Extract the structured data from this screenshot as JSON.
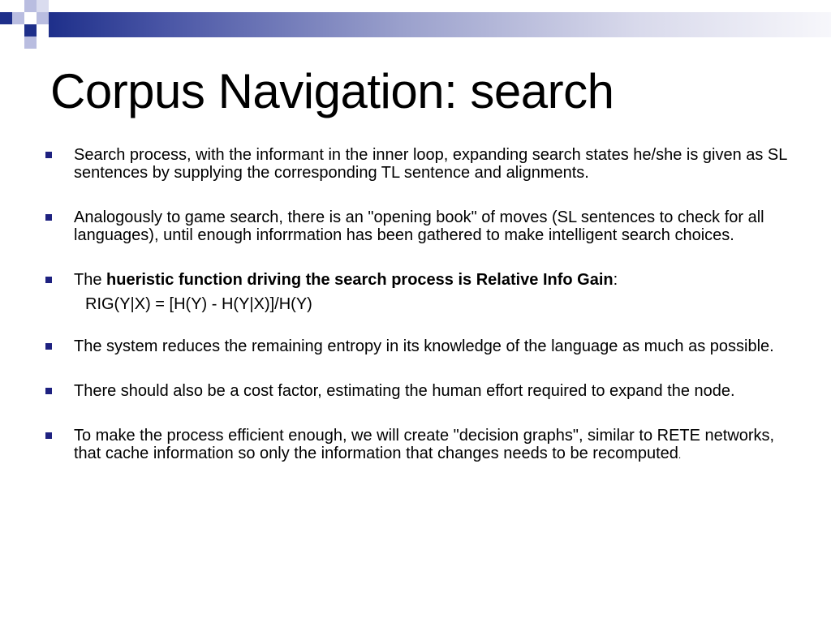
{
  "slide": {
    "title": "Corpus Navigation: search",
    "bullets": [
      {
        "text": "Search process, with the informant in the inner loop, expanding search states he/she is given as SL sentences by supplying the corresponding TL sentence and alignments."
      },
      {
        "text": "Analogously to game search, there is an \"opening book\" of moves (SL sentences to check for all languages), until enough inforrmation has been gathered to make intelligent search choices."
      },
      {
        "prefix": "The ",
        "bold": "hueristic function driving the search process is Relative Info Gain",
        "suffix": ":",
        "formula": "RIG(Y|X) = [H(Y) - H(Y|X)]/H(Y)"
      },
      {
        "text": "The system reduces the remaining entropy in its knowledge of the language as much as possible."
      },
      {
        "text": "There should also be a cost factor, estimating the human effort required to expand the node."
      },
      {
        "text": "To make the process efficient enough, we will create \"decision graphs\", similar to RETE networks, that cache information so only the information that changes needs to be recomputed",
        "trailing": "."
      }
    ]
  },
  "colors": {
    "accent": "#1e2180",
    "header_dark": "#1e2f8a",
    "header_light": "#b9bde0"
  }
}
